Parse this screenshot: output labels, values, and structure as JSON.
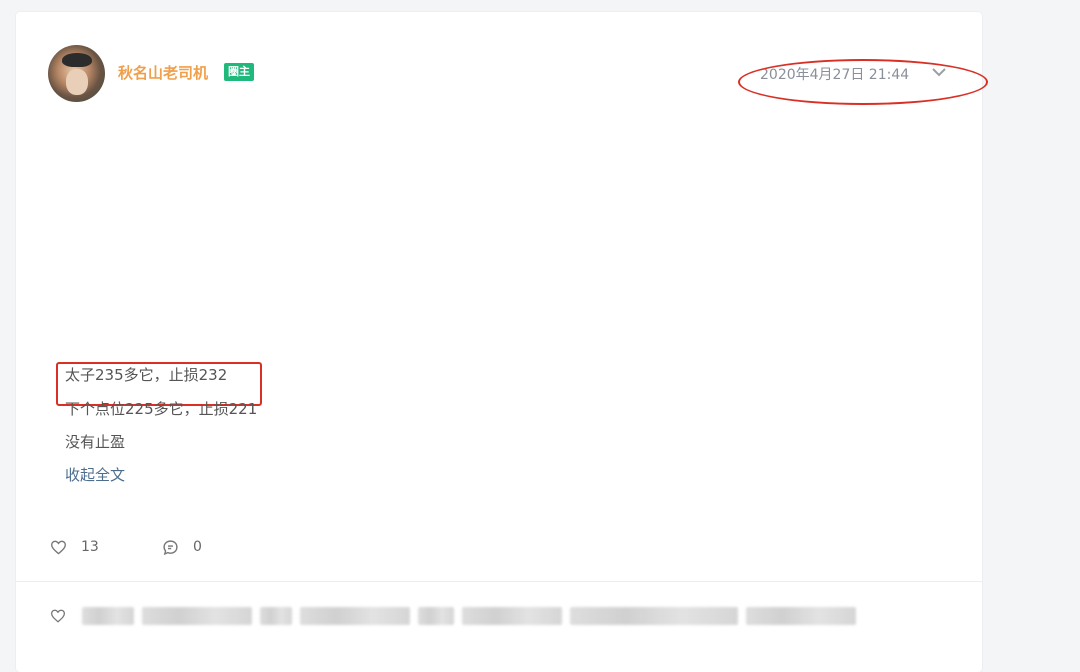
{
  "post": {
    "author": "秋名山老司机",
    "badge": "圈主",
    "timestamp": "2020年4月27日 21:44",
    "lines": [
      "太子235多它，止损232",
      "下个点位225多它，止损221",
      "没有止盈"
    ],
    "collapse_label": "收起全文",
    "likes": "13",
    "comments": "0"
  },
  "icons": {
    "avatar": "user-avatar",
    "menu": "chevron-down-icon",
    "like": "heart-icon",
    "comment": "comment-icon"
  },
  "annotation_color": "#d93025",
  "author_color": "#f0a04b",
  "badge_color": "#1fb97b",
  "link_color": "#4c6d8e"
}
